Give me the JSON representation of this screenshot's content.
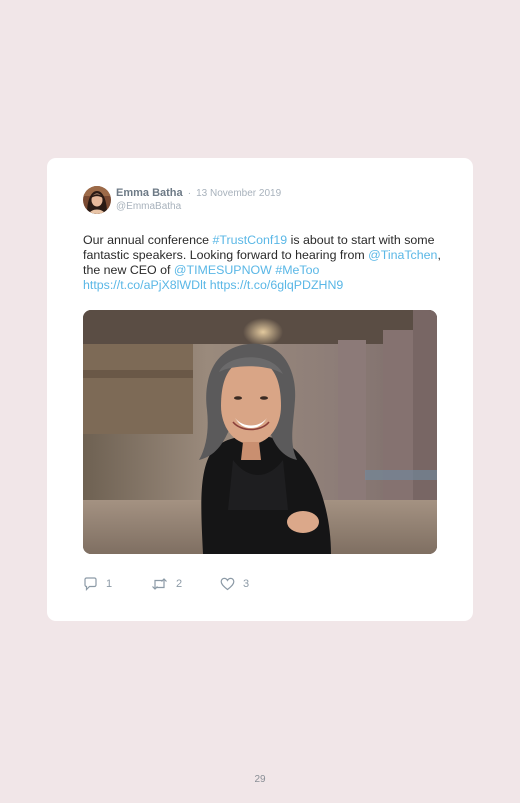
{
  "tweet": {
    "author_name": "Emma Batha",
    "separator": "·",
    "date": "13 November 2019",
    "handle": "@EmmaBatha",
    "text_part1": "Our annual conference ",
    "hashtag1": "#TrustConf19",
    "text_part2": " is about to start with some fantastic speakers. Looking forward to hearing from ",
    "mention1": "@TinaTchen",
    "text_part3": ", the new CEO of ",
    "mention2": "@TIMESUPNOW",
    "hashtag2": "#MeToo",
    "link1": "https://t.co/aPjX8lWDlt",
    "link2": "https://t.co/6glqPDZHN9",
    "link_color": "#5ab7e6",
    "photo": {
      "description_icon": "person-photo"
    }
  },
  "actions": {
    "replies": "1",
    "retweets": "2",
    "likes": "3"
  },
  "page": {
    "number": "29",
    "background": "#f1e6e8"
  }
}
